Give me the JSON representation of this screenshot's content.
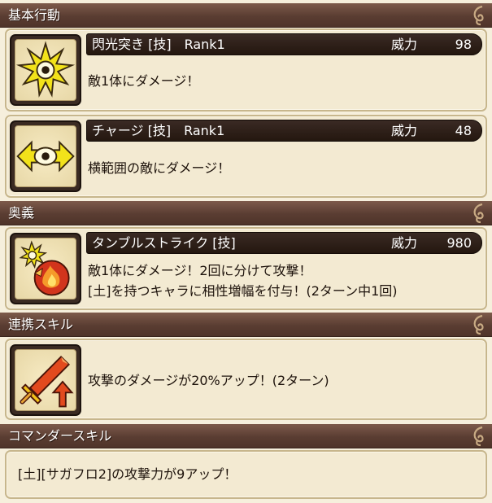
{
  "sections": {
    "basic": {
      "title": "基本行動"
    },
    "ougi": {
      "title": "奥義"
    },
    "link": {
      "title": "連携スキル"
    },
    "commander": {
      "title": "コマンダースキル"
    }
  },
  "skills": [
    {
      "name": "閃光突き [技]　Rank1",
      "power_label": "威力",
      "power": "98",
      "desc": [
        "敵1体にダメージ！"
      ],
      "icon": "star-burst-icon"
    },
    {
      "name": "チャージ [技]　Rank1",
      "power_label": "威力",
      "power": "48",
      "desc": [
        "横範囲の敵にダメージ！"
      ],
      "icon": "eye-arrow-icon"
    },
    {
      "name": "タンブルストライク [技]",
      "power_label": "威力",
      "power": "980",
      "desc": [
        "敵1体にダメージ！2回に分けて攻撃！",
        "[土]を持つキャラに相性増幅を付与！(2ターン中1回)"
      ],
      "icon": "burst-fire-icon"
    }
  ],
  "link_skill": {
    "desc": "攻撃のダメージが20%アップ！(2ターン)",
    "icon": "sword-up-icon"
  },
  "commander_skill": {
    "desc": "[土][サガフロ2]の攻撃力が9アップ！"
  },
  "colors": {
    "header": "#5f4236",
    "card": "#f3ead2",
    "bar": "#2a1c14",
    "accent_yellow": "#f2e21a",
    "accent_red": "#d2341c"
  }
}
